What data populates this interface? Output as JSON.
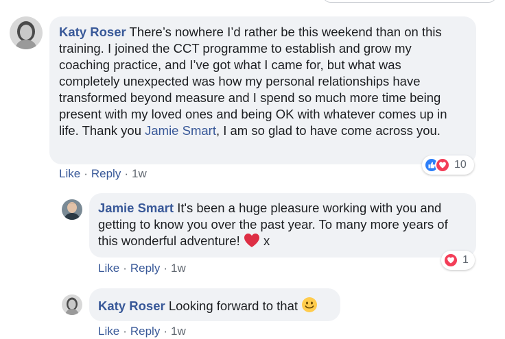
{
  "comment1": {
    "author": "Katy Roser",
    "text_before": "There’s nowhere I’d rather be this weekend than on this training. I joined the CCT programme to establish and grow my coaching practice, and I’ve got what I came for, but what was completely unexpected was how my personal relationships have transformed beyond measure and I spend so much more time being present with my loved ones and being OK with whatever comes up in life. Thank you ",
    "mention": "Jamie Smart",
    "text_after": ", I am so glad to have come across you.",
    "like_label": "Like",
    "reply_label": "Reply",
    "separator": "·",
    "time": "1w",
    "reaction_count": "10",
    "reaction_icons": [
      "like-icon",
      "love-icon"
    ]
  },
  "comment2": {
    "author": "Jamie Smart",
    "text": "It's been a huge pleasure working with you and getting to know you over the past year. To many more years of this wonderful adventure!",
    "text_after_heart": " x",
    "like_label": "Like",
    "reply_label": "Reply",
    "separator": "·",
    "time": "1w",
    "reaction_count": "1",
    "reaction_icons": [
      "love-icon"
    ]
  },
  "comment3": {
    "author": "Katy Roser",
    "text": "Looking forward to that",
    "like_label": "Like",
    "reply_label": "Reply",
    "separator": "·",
    "time": "1w",
    "emoji": "smile-emoji"
  },
  "colors": {
    "link": "#385898",
    "bubble": "#f0f2f5",
    "like": "#2d7ff9",
    "love": "#f33e58",
    "meta": "#606770"
  }
}
